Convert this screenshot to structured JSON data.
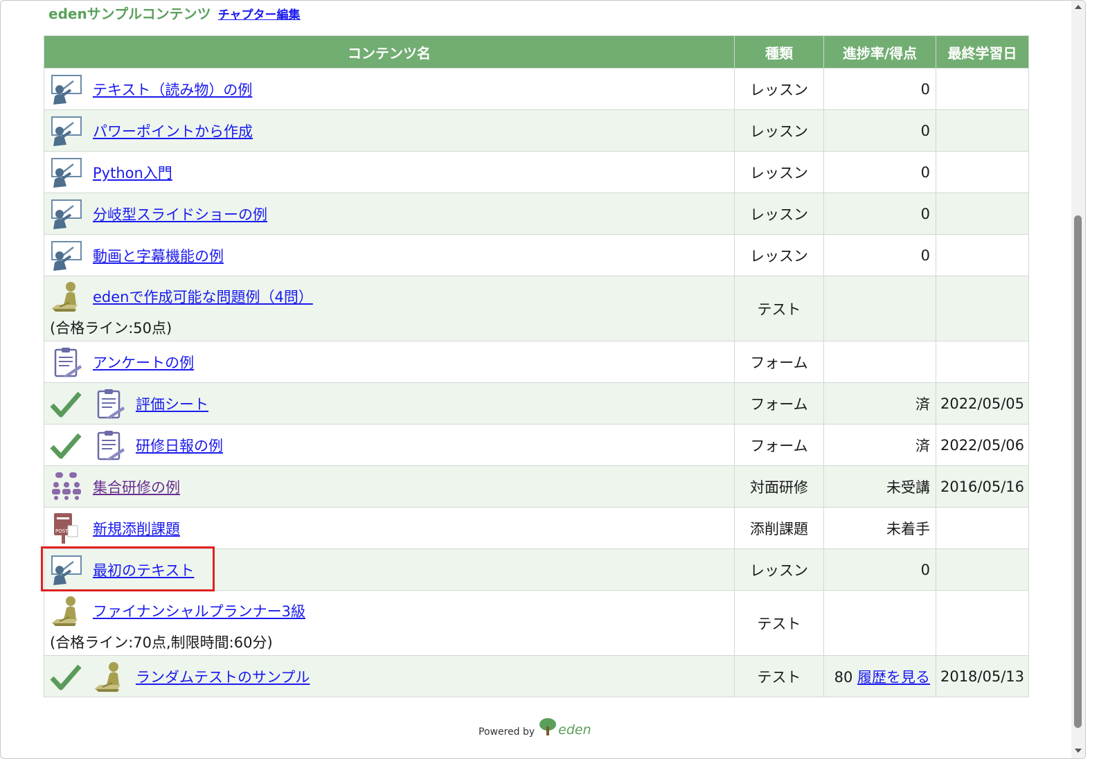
{
  "header": {
    "title": "edenサンプルコンテンツ",
    "edit_link": "チャプター編集"
  },
  "table": {
    "columns": [
      "コンテンツ名",
      "種類",
      "進捗率/得点",
      "最終学習日"
    ],
    "rows": [
      {
        "name": "テキスト（読み物）の例",
        "note": "",
        "type": "レッスン",
        "score": "0",
        "date": "",
        "icon": "lesson-icon",
        "check": false
      },
      {
        "name": "パワーポイントから作成",
        "note": "",
        "type": "レッスン",
        "score": "0",
        "date": "",
        "icon": "lesson-icon",
        "check": false
      },
      {
        "name": "Python入門",
        "note": "",
        "type": "レッスン",
        "score": "0",
        "date": "",
        "icon": "lesson-icon",
        "check": false
      },
      {
        "name": "分岐型スライドショーの例",
        "note": "",
        "type": "レッスン",
        "score": "0",
        "date": "",
        "icon": "lesson-icon",
        "check": false
      },
      {
        "name": "動画と字幕機能の例",
        "note": "",
        "type": "レッスン",
        "score": "0",
        "date": "",
        "icon": "lesson-icon",
        "check": false
      },
      {
        "name": "edenで作成可能な問題例（4問）",
        "note": "(合格ライン:50点)",
        "type": "テスト",
        "score": "",
        "date": "",
        "icon": "test-icon",
        "check": false
      },
      {
        "name": "アンケートの例",
        "note": "",
        "type": "フォーム",
        "score": "",
        "date": "",
        "icon": "form-icon",
        "check": false
      },
      {
        "name": "評価シート",
        "note": "",
        "type": "フォーム",
        "score": "済",
        "date": "2022/05/05",
        "icon": "form-icon",
        "check": true
      },
      {
        "name": "研修日報の例",
        "note": "",
        "type": "フォーム",
        "score": "済",
        "date": "2022/05/06",
        "icon": "form-icon",
        "check": true
      },
      {
        "name": "集合研修の例",
        "note": "",
        "type": "対面研修",
        "score": "未受講",
        "date": "2016/05/16",
        "icon": "group-training-icon",
        "check": false
      },
      {
        "name": "新規添削課題",
        "note": "",
        "type": "添削課題",
        "score": "未着手",
        "date": "",
        "icon": "post-icon",
        "check": false
      },
      {
        "name": "最初のテキスト",
        "note": "",
        "type": "レッスン",
        "score": "0",
        "date": "",
        "icon": "lesson-icon",
        "check": false
      },
      {
        "name": "ファイナンシャルプランナー3級",
        "note": "(合格ライン:70点,制限時間:60分)",
        "type": "テスト",
        "score": "",
        "date": "",
        "icon": "test-icon",
        "check": false
      },
      {
        "name": "ランダムテストのサンプル",
        "note": "",
        "type": "テスト",
        "score": "80",
        "score_link": "履歴を見る",
        "date": "2018/05/13",
        "icon": "test-icon",
        "check": true
      }
    ]
  },
  "footer": {
    "powered_by": "Powered by",
    "brand": "eden"
  },
  "colors": {
    "header_bg": "#72ad72",
    "row_alt": "#edf5ed",
    "link": "#1a1aee",
    "highlight": "#e02020",
    "check": "#5a9a5a"
  }
}
